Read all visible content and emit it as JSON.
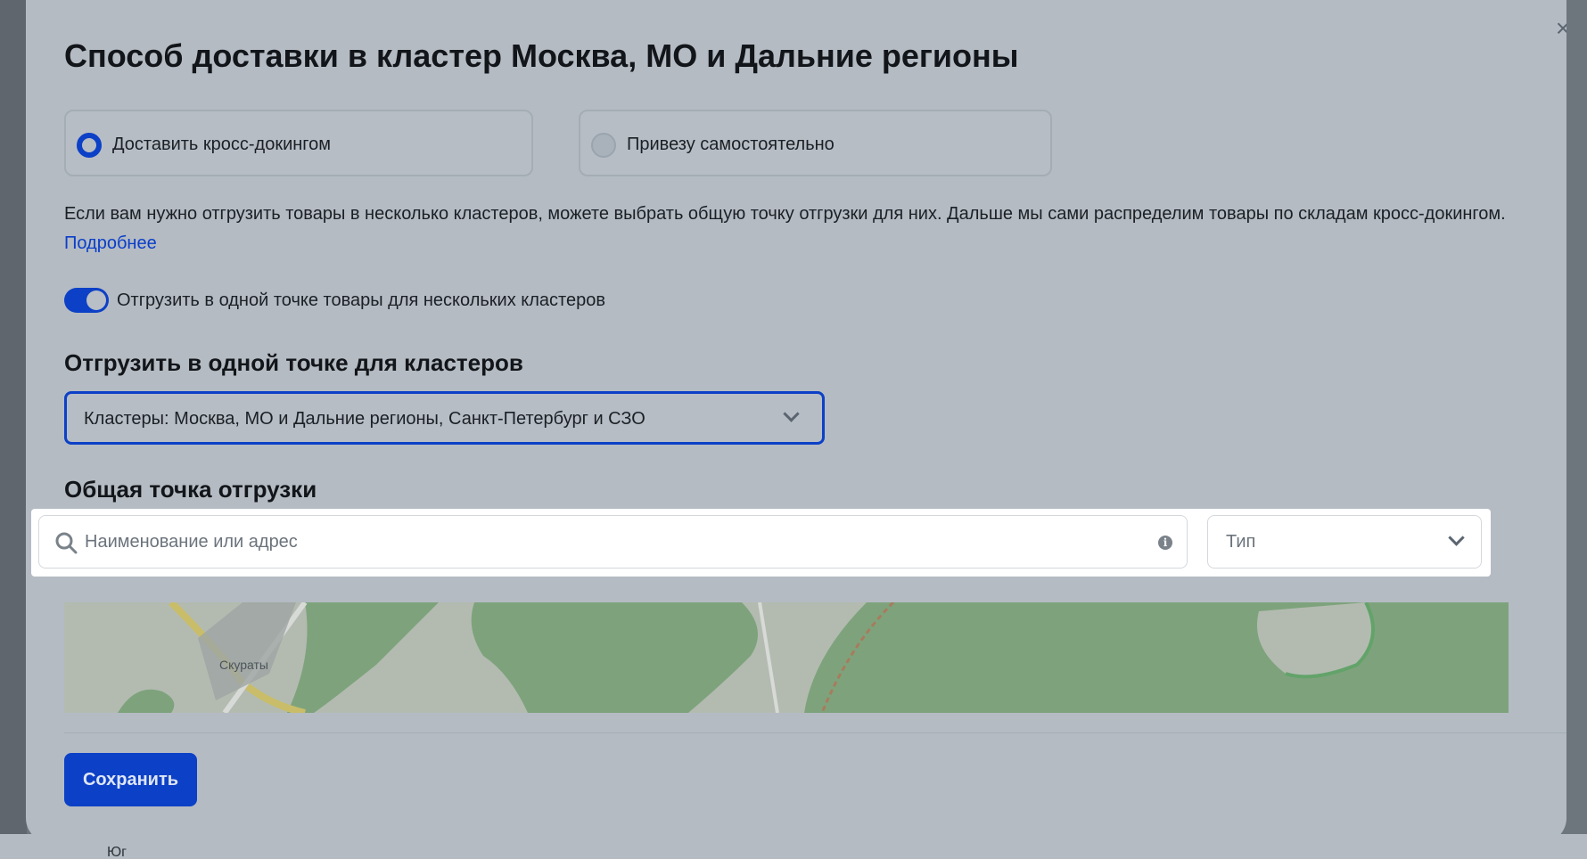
{
  "modal": {
    "title": "Способ доставки в кластер Москва, МО и Дальние регионы",
    "close_label": "×"
  },
  "delivery_options": [
    {
      "label": "Доставить кросс-докингом",
      "selected": true
    },
    {
      "label": "Привезу самостоятельно",
      "selected": false
    }
  ],
  "info": {
    "text": "Если вам нужно отгрузить товары в несколько кластеров, можете выбрать общую точку отгрузки для них. Дальше мы сами распределим товары по складам кросс-докингом.",
    "link": "Подробнее"
  },
  "toggle": {
    "label": "Отгрузить в одной точке товары для нескольких кластеров",
    "on": true
  },
  "clusters_section": {
    "heading": "Отгрузить в одной точке для кластеров",
    "selected_value": "Кластеры: Москва, МО и Дальние регионы, Санкт-Петербург и СЗО"
  },
  "shipping_point": {
    "heading": "Общая точка отгрузки",
    "search_placeholder": "Наименование или адрес",
    "type_placeholder": "Тип"
  },
  "map": {
    "place_label": "Скураты"
  },
  "footer": {
    "save_label": "Сохранить"
  },
  "background": {
    "bottom_text": "Юг"
  },
  "colors": {
    "accent": "#0c40c6",
    "link": "#0a3ec9",
    "overlay": "#b4bbc3",
    "map_forest": "#7ea37c",
    "map_field": "#b3bbb1"
  }
}
